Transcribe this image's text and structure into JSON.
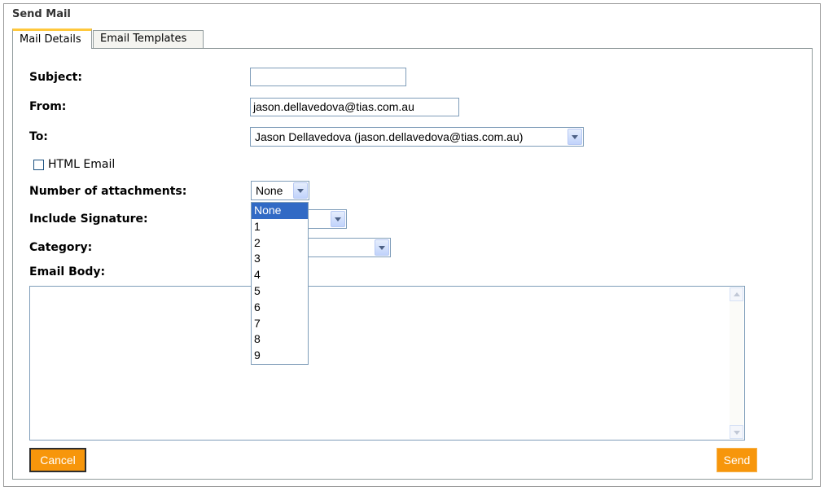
{
  "page": {
    "title": "Send Mail"
  },
  "tabs": [
    {
      "label": "Mail Details",
      "active": true
    },
    {
      "label": "Email Templates",
      "active": false
    }
  ],
  "form": {
    "subject": {
      "label": "Subject:",
      "value": ""
    },
    "from": {
      "label": "From:",
      "value": "jason.dellavedova@tias.com.au"
    },
    "to": {
      "label": "To:",
      "value": "Jason Dellavedova (jason.dellavedova@tias.com.au)"
    },
    "html_email": {
      "label": "HTML Email",
      "checked": false
    },
    "attachments": {
      "label": "Number of attachments:",
      "value": "None",
      "options": [
        "None",
        "1",
        "2",
        "3",
        "4",
        "5",
        "6",
        "7",
        "8",
        "9"
      ],
      "selected_option": "None"
    },
    "signature": {
      "label": "Include Signature:",
      "value": ""
    },
    "category": {
      "label": "Category:",
      "value": ""
    },
    "body": {
      "label": "Email Body:",
      "value": ""
    }
  },
  "buttons": {
    "cancel": "Cancel",
    "send": "Send"
  },
  "colors": {
    "button_bg": "#f7960b",
    "tab_active_accent": "#ffc83c",
    "selection": "#316ac5",
    "field_border": "#7f9db9"
  }
}
